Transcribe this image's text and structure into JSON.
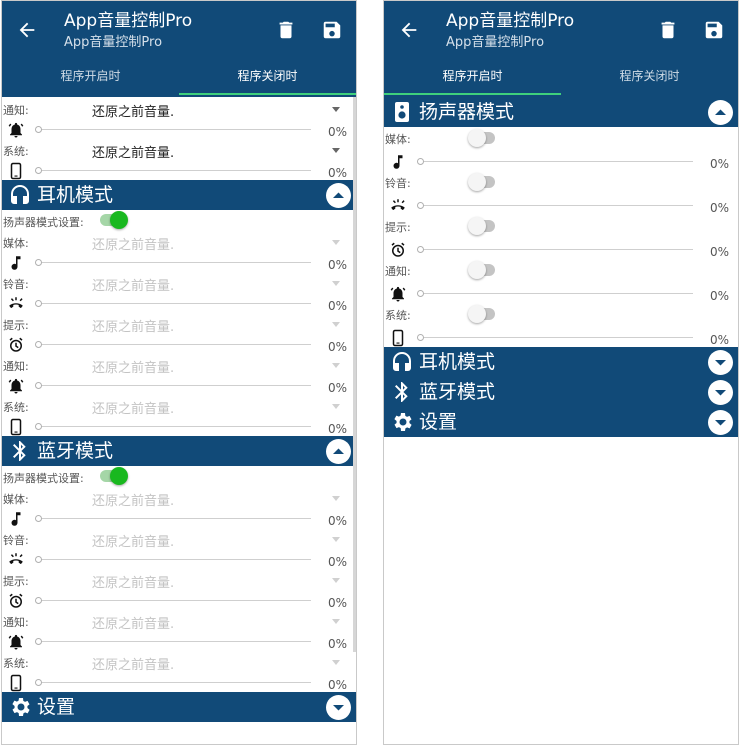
{
  "app": {
    "title": "App音量控制Pro",
    "subtitle": "App音量控制Pro"
  },
  "screens": [
    {
      "active_tab": 1,
      "tabs": [
        "程序开启时",
        "程序关闭时"
      ],
      "top_partial": [
        {
          "type": "slider",
          "icon": "alarm-icon",
          "pct": "0%"
        },
        {
          "type": "label",
          "label": "通知:",
          "value": "还原之前音量.",
          "dim": false
        },
        {
          "type": "slider",
          "icon": "notification-bell-icon",
          "pct": "0%"
        },
        {
          "type": "label",
          "label": "系统:",
          "value": "还原之前音量.",
          "dim": false
        },
        {
          "type": "slider",
          "icon": "phone-icon",
          "pct": "0%"
        }
      ],
      "sections": [
        {
          "key": "headphone",
          "title": "耳机模式",
          "icon": "headphones-icon",
          "expanded": true,
          "pref_label": "扬声器模式设置:",
          "pref_on": true,
          "rows": [
            {
              "label": "媒体:",
              "value": "还原之前音量.",
              "icon": "music-note-icon",
              "pct": "0%"
            },
            {
              "label": "铃音:",
              "value": "还原之前音量.",
              "icon": "ringer-icon",
              "pct": "0%"
            },
            {
              "label": "提示:",
              "value": "还原之前音量.",
              "icon": "alarm-icon",
              "pct": "0%"
            },
            {
              "label": "通知:",
              "value": "还原之前音量.",
              "icon": "notification-bell-icon",
              "pct": "0%"
            },
            {
              "label": "系统:",
              "value": "还原之前音量.",
              "icon": "phone-icon",
              "pct": "0%"
            }
          ]
        },
        {
          "key": "bluetooth",
          "title": "蓝牙模式",
          "icon": "bluetooth-icon",
          "expanded": true,
          "pref_label": "扬声器模式设置:",
          "pref_on": true,
          "rows": [
            {
              "label": "媒体:",
              "value": "还原之前音量.",
              "icon": "music-note-icon",
              "pct": "0%"
            },
            {
              "label": "铃音:",
              "value": "还原之前音量.",
              "icon": "ringer-icon",
              "pct": "0%"
            },
            {
              "label": "提示:",
              "value": "还原之前音量.",
              "icon": "alarm-icon",
              "pct": "0%"
            },
            {
              "label": "通知:",
              "value": "还原之前音量.",
              "icon": "notification-bell-icon",
              "pct": "0%"
            },
            {
              "label": "系统:",
              "value": "还原之前音量.",
              "icon": "phone-icon",
              "pct": "0%"
            }
          ]
        },
        {
          "key": "settings",
          "title": "设置",
          "icon": "gear-icon",
          "expanded": false
        }
      ]
    },
    {
      "active_tab": 0,
      "tabs": [
        "程序开启时",
        "程序关闭时"
      ],
      "sections": [
        {
          "key": "speaker",
          "title": "扬声器模式",
          "icon": "speaker-icon",
          "expanded": true,
          "rows": [
            {
              "label": "媒体:",
              "toggle": false,
              "icon": "music-note-icon",
              "pct": "0%"
            },
            {
              "label": "铃音:",
              "toggle": false,
              "icon": "ringer-icon",
              "pct": "0%"
            },
            {
              "label": "提示:",
              "toggle": false,
              "icon": "alarm-icon",
              "pct": "0%"
            },
            {
              "label": "通知:",
              "toggle": false,
              "icon": "notification-bell-icon",
              "pct": "0%"
            },
            {
              "label": "系统:",
              "toggle": false,
              "icon": "phone-icon",
              "pct": "0%"
            }
          ]
        },
        {
          "key": "headphone",
          "title": "耳机模式",
          "icon": "headphones-icon",
          "expanded": false
        },
        {
          "key": "bluetooth",
          "title": "蓝牙模式",
          "icon": "bluetooth-icon",
          "expanded": false
        },
        {
          "key": "settings",
          "title": "设置",
          "icon": "gear-icon",
          "expanded": false
        }
      ]
    }
  ],
  "colors": {
    "primary": "#114a78",
    "accent": "#3fd07c",
    "switch_on": "#19b81f"
  }
}
